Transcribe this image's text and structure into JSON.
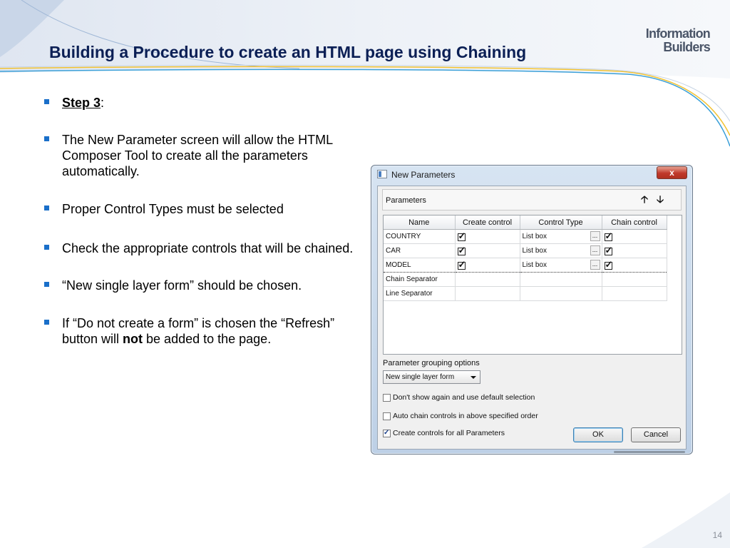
{
  "slide": {
    "title": "Building a Procedure to create an HTML page using Chaining",
    "logo_line1": "Information",
    "logo_line2": "Builders",
    "page_number": "14",
    "bullets": {
      "step_label": "Step 3",
      "step_suffix": ":",
      "b2": "The New Parameter screen will allow the HTML Composer Tool to create all the parameters automatically.",
      "b3": "Proper Control Types must be selected",
      "b4": "Check the appropriate controls that will be chained.",
      "b5": "“New single layer form” should be chosen.",
      "b6_pre": "If “Do not create a form” is chosen the “Refresh” button will ",
      "b6_bold": "not",
      "b6_post": " be added to the page."
    }
  },
  "dialog": {
    "title": "New Parameters",
    "close_label": "x",
    "params_section_label": "Parameters",
    "move_up_glyph": "🡡",
    "move_down_glyph": "🡣",
    "columns": [
      "Name",
      "Create control",
      "Control Type",
      "Chain control"
    ],
    "rows": [
      {
        "name": "COUNTRY",
        "create_control": true,
        "control_type": "List box",
        "ellipsis": "...",
        "chain_control": true
      },
      {
        "name": "CAR",
        "create_control": true,
        "control_type": "List box",
        "ellipsis": "...",
        "chain_control": true
      },
      {
        "name": "MODEL",
        "create_control": true,
        "control_type": "List box",
        "ellipsis": "...",
        "chain_control": true
      },
      {
        "name": "Chain Separator",
        "create_control": false,
        "control_type": "",
        "ellipsis": "",
        "chain_control": false
      },
      {
        "name": "Line Separator",
        "create_control": false,
        "control_type": "",
        "ellipsis": "",
        "chain_control": false
      }
    ],
    "grouping_label": "Parameter grouping options",
    "grouping_selected": "New single layer form",
    "checkboxes": [
      {
        "label": "Don't show again and use default selection",
        "checked": false
      },
      {
        "label": "Auto chain controls in above specified order",
        "checked": false
      },
      {
        "label": "Create controls for all Parameters",
        "checked": true
      }
    ],
    "ok_label": "OK",
    "cancel_label": "Cancel"
  },
  "colors": {
    "title_color": "#0b1f55",
    "bullet_marker": "#1a6fc9",
    "close_button": "#c0392b"
  }
}
